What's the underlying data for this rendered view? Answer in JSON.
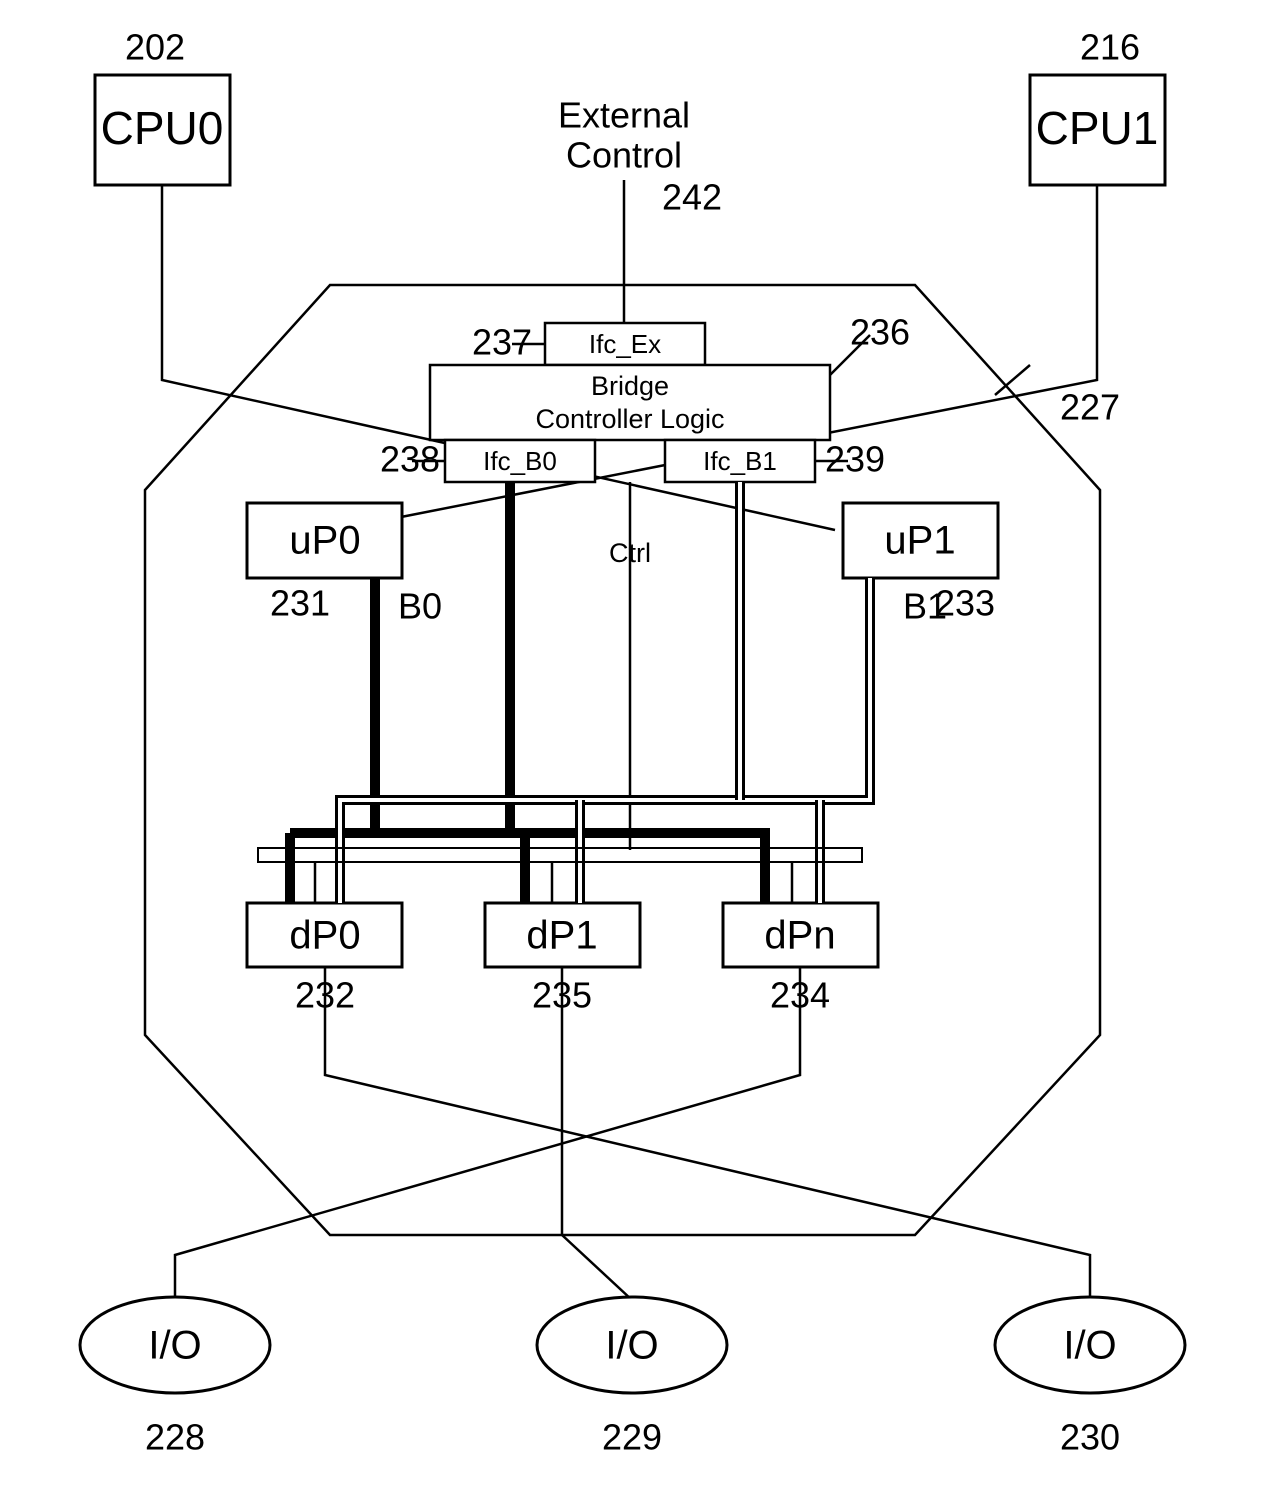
{
  "external": {
    "label_line1": "External",
    "label_line2": "Control",
    "ref": "242"
  },
  "cpu": {
    "left": {
      "label": "CPU0",
      "ref": "202"
    },
    "right": {
      "label": "CPU1",
      "ref": "216"
    }
  },
  "bridge": {
    "ref": "227",
    "controller": {
      "label_line1": "Bridge",
      "label_line2": "Controller Logic",
      "ref": "236"
    },
    "ifc_ex": {
      "label": "Ifc_Ex",
      "ref": "237"
    },
    "ifc_b0": {
      "label": "Ifc_B0",
      "ref": "238"
    },
    "ifc_b1": {
      "label": "Ifc_B1",
      "ref": "239"
    },
    "ctrl_label": "Ctrl",
    "up": [
      {
        "label": "uP0",
        "ref": "231"
      },
      {
        "label": "uP1",
        "ref": "233"
      }
    ],
    "down": [
      {
        "label": "dP0",
        "ref": "232"
      },
      {
        "label": "dP1",
        "ref": "235"
      },
      {
        "label": "dPn",
        "ref": "234"
      }
    ],
    "bus": {
      "b0": "B0",
      "b1": "B1"
    }
  },
  "io": [
    {
      "label": "I/O",
      "ref": "228"
    },
    {
      "label": "I/O",
      "ref": "229"
    },
    {
      "label": "I/O",
      "ref": "230"
    }
  ]
}
